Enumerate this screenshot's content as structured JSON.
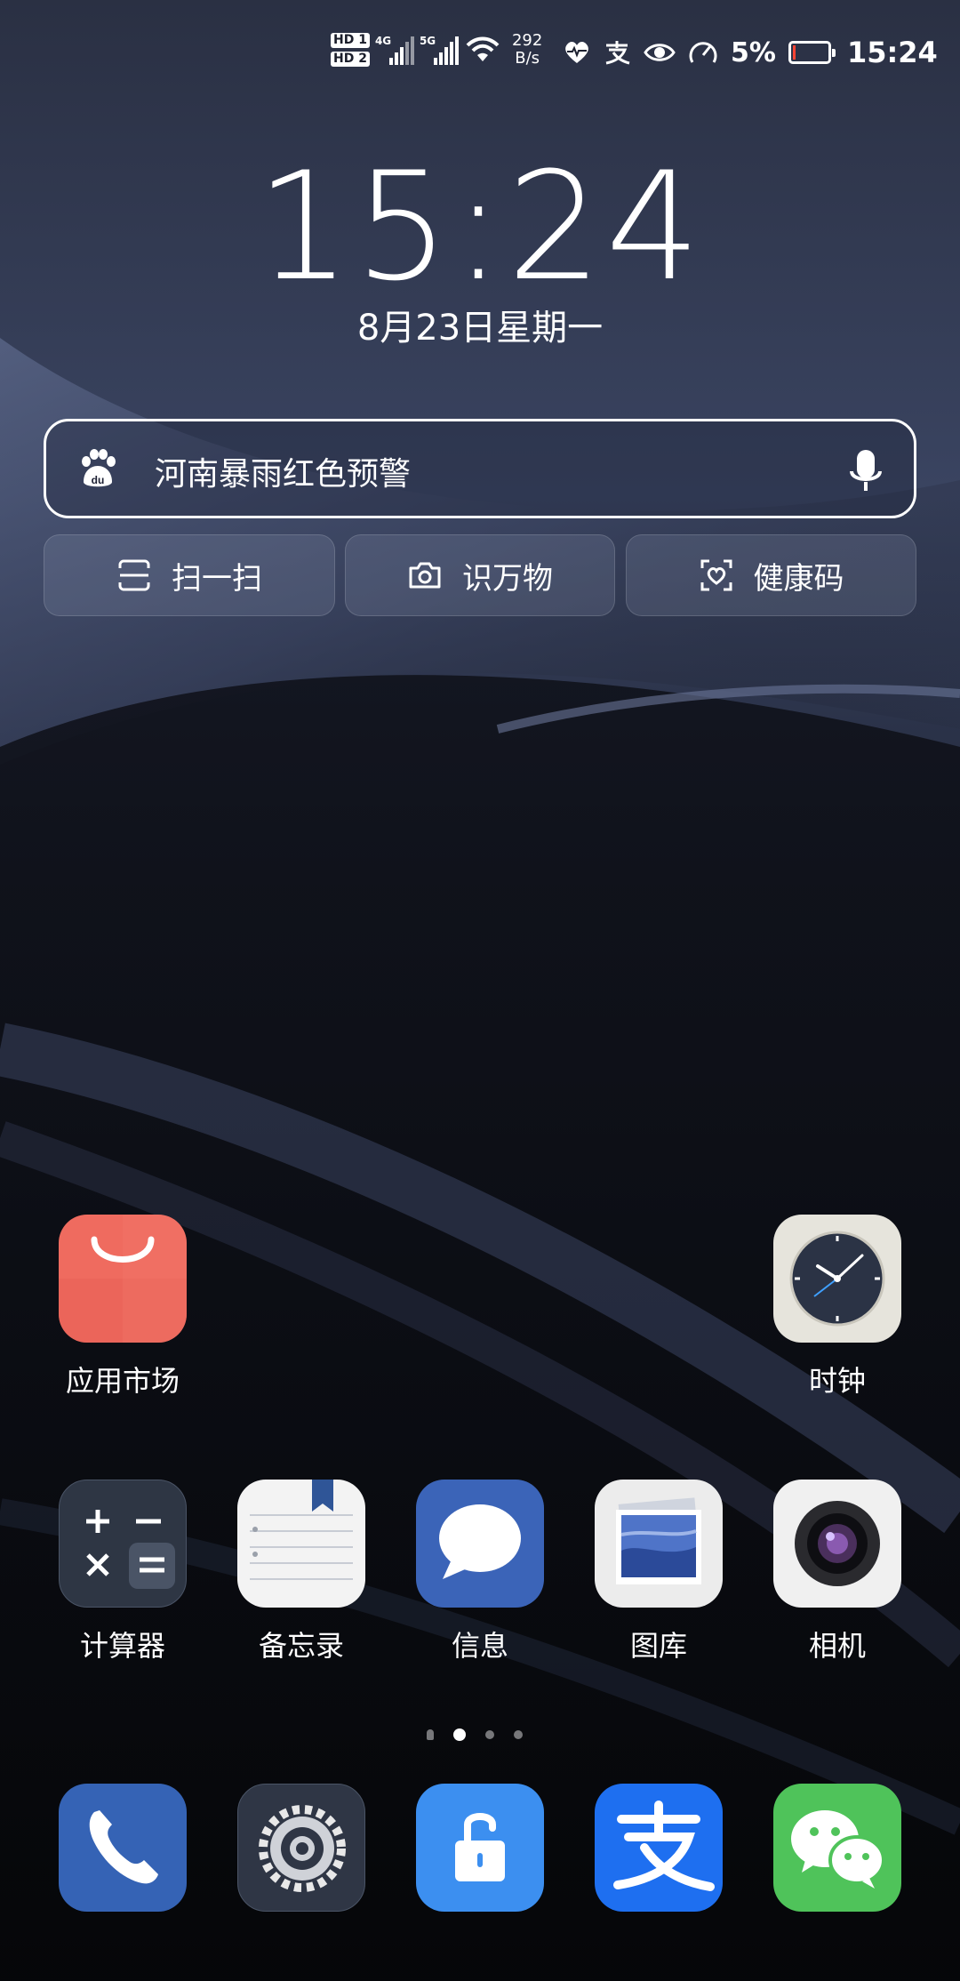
{
  "status_bar": {
    "sim1": "HD 1",
    "sim2": "HD 2",
    "net1": "4G",
    "net2": "5G",
    "net_speed_value": "292",
    "net_speed_unit": "B/s",
    "battery_percent": "5%",
    "battery_level": 0.05,
    "time": "15:24",
    "icons": [
      "wifi-icon",
      "heart-rate-icon",
      "alipay-icon",
      "eye-icon",
      "speedometer-icon"
    ]
  },
  "clock": {
    "time": "15:24",
    "date": "8月23日星期一"
  },
  "search": {
    "query": "河南暴雨红色预警",
    "icons": [
      "baidu-paw-icon",
      "microphone-icon"
    ]
  },
  "quick_actions": [
    {
      "label": "扫一扫",
      "icon": "scan-icon"
    },
    {
      "label": "识万物",
      "icon": "camera-icon"
    },
    {
      "label": "健康码",
      "icon": "health-code-icon"
    }
  ],
  "apps_row1": [
    {
      "label": "应用市场",
      "icon": "app-market-icon",
      "color": "#ef6b5f"
    },
    {
      "label": "时钟",
      "icon": "clock-icon",
      "color": "#e6e4dc"
    }
  ],
  "apps_row2": [
    {
      "label": "计算器",
      "icon": "calculator-icon",
      "color": "#2e3644"
    },
    {
      "label": "备忘录",
      "icon": "notepad-icon",
      "color": "#f3f3f3"
    },
    {
      "label": "信息",
      "icon": "messages-icon",
      "color": "#3b64b8"
    },
    {
      "label": "图库",
      "icon": "gallery-icon",
      "color": "#ececec"
    },
    {
      "label": "相机",
      "icon": "camera-app-icon",
      "color": "#f0f0f0"
    }
  ],
  "dock": [
    {
      "icon": "phone-icon",
      "color": "#3563b5"
    },
    {
      "icon": "settings-icon",
      "color": "#2f3645"
    },
    {
      "icon": "unlock-icon",
      "color": "#3c8ff0"
    },
    {
      "icon": "alipay-app-icon",
      "color": "#1e6ff0"
    },
    {
      "icon": "wechat-icon",
      "color": "#4fc35a"
    }
  ],
  "page_indicator": {
    "pages": 3,
    "current": 1
  }
}
